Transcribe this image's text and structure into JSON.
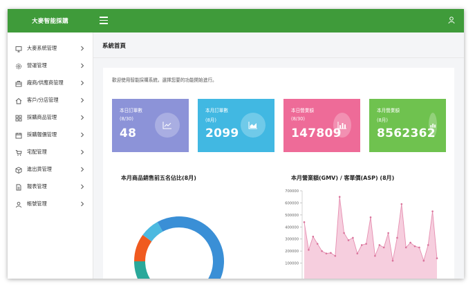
{
  "app": {
    "brand": "大麥智能採購"
  },
  "colors": {
    "topbar": "#3f9b3a",
    "card1": "#8c93d8",
    "card2": "#41b8e2",
    "card3": "#ee6b98",
    "card4": "#6fc24f"
  },
  "icons": {
    "menu": "hamburger-icon",
    "user": "user-icon",
    "chevron": "chevron-right-icon"
  },
  "sidebar": {
    "items": [
      {
        "label": "大麥系統管理",
        "icon": "monitor-icon"
      },
      {
        "label": "營運管理",
        "icon": "gear-icon"
      },
      {
        "label": "廠商/供應商管理",
        "icon": "store-icon"
      },
      {
        "label": "客戶/分店管理",
        "icon": "home-icon"
      },
      {
        "label": "採購商品管理",
        "icon": "grid-icon"
      },
      {
        "label": "採購報價管理",
        "icon": "calendar-icon"
      },
      {
        "label": "宅配管理",
        "icon": "cart-icon"
      },
      {
        "label": "進出貨管理",
        "icon": "box-icon"
      },
      {
        "label": "報表管理",
        "icon": "document-icon"
      },
      {
        "label": "帳號管理",
        "icon": "person-icon"
      }
    ]
  },
  "main": {
    "page_title": "系統首頁",
    "welcome": "歡迎使用智能採購系統，選擇您要的功能開始進行。"
  },
  "stats": [
    {
      "label": "本日訂單數",
      "sub": "(8/30)",
      "value": "48",
      "icon": "line-chart-icon"
    },
    {
      "label": "本月訂單數",
      "sub": "(8月)",
      "value": "2099",
      "icon": "area-chart-icon"
    },
    {
      "label": "本日營業額",
      "sub": "(8/30)",
      "value": "147809",
      "icon": "bar-chart-icon"
    },
    {
      "label": "本月營業額",
      "sub": "(8月)",
      "value": "8562362",
      "icon": "bar-chart-icon"
    }
  ],
  "chart_data": [
    {
      "type": "pie",
      "title": "本月商品銷售前五名佔比(8月)",
      "values": [
        66,
        9,
        10,
        7,
        8
      ],
      "colors": [
        "#3a8fd6",
        "#2aa89a",
        "#f05a1f",
        "#4cb9e0",
        "#3a8fd6"
      ]
    },
    {
      "type": "area",
      "title": "本月營業額(GMV) / 客單價(ASP) (8月)",
      "ylim": [
        0,
        700000
      ],
      "yticks": [
        "700000",
        "600000",
        "500000",
        "400000",
        "300000",
        "200000",
        "100000"
      ],
      "values": [
        440000,
        210000,
        320000,
        260000,
        200000,
        180000,
        185000,
        160000,
        650000,
        350000,
        290000,
        310000,
        180000,
        250000,
        260000,
        480000,
        160000,
        250000,
        230000,
        350000,
        120000,
        310000,
        590000,
        230000,
        270000,
        240000,
        230000,
        120000,
        250000,
        530000,
        140000
      ],
      "color": "#f5c6d8",
      "line_color": "#e58eb0"
    }
  ]
}
